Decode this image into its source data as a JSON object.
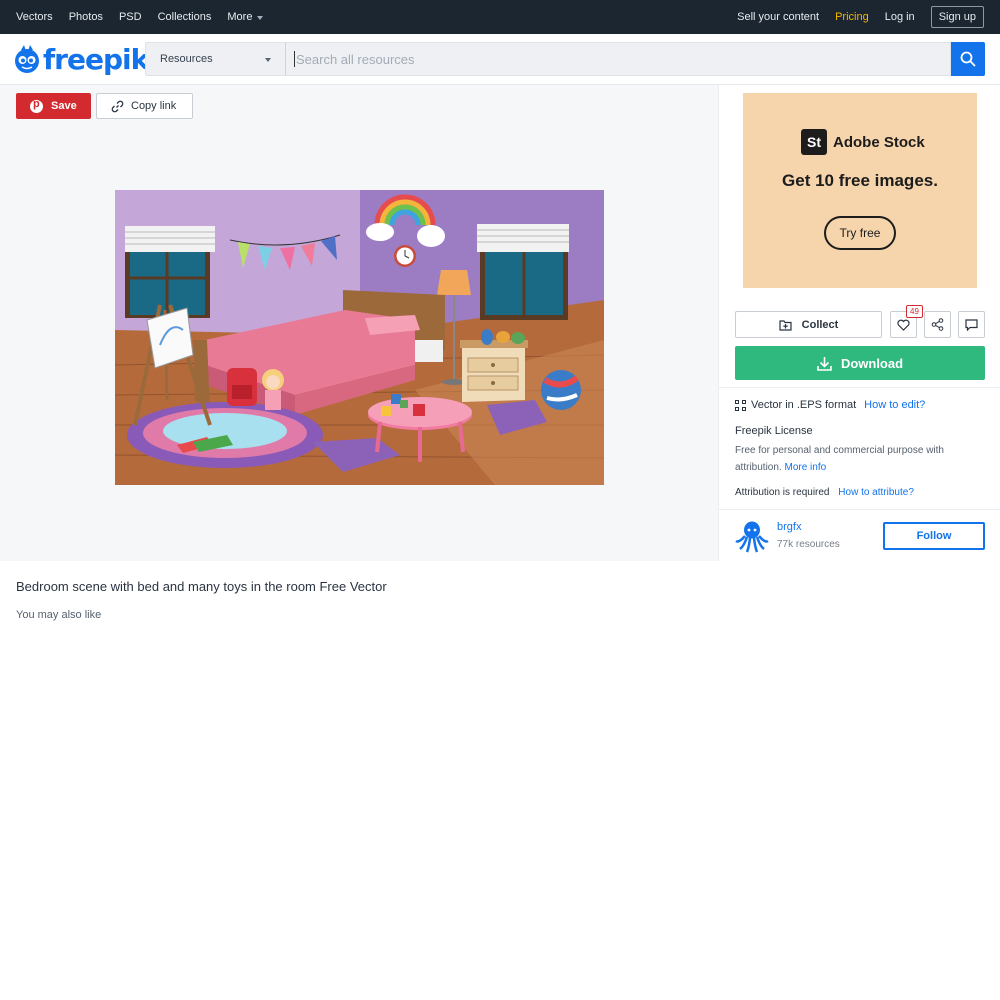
{
  "topnav": {
    "left_items": [
      "Vectors",
      "Photos",
      "PSD",
      "Collections",
      "More"
    ],
    "sell": "Sell your content",
    "pricing": "Pricing",
    "login": "Log in",
    "signup": "Sign up"
  },
  "header": {
    "logo_text": "freepik",
    "search_category": "Resources",
    "search_placeholder": "Search all resources"
  },
  "preview": {
    "save_label": "Save",
    "copy_link_label": "Copy link",
    "image_icon": "bedroom-illustration"
  },
  "ad": {
    "brand_mark": "St",
    "brand_name": "Adobe Stock",
    "headline": "Get 10 free images.",
    "cta": "Try free"
  },
  "actions": {
    "collect_label": "Collect",
    "like_count": "49",
    "download_label": "Download"
  },
  "info": {
    "format_text": "Vector in .EPS format",
    "format_link": "How to edit?",
    "license_title": "Freepik License",
    "license_desc": "Free for personal and commercial purpose with attribution.",
    "license_link": "More info",
    "attribution_text": "Attribution is required",
    "attribution_link": "How to attribute?"
  },
  "author": {
    "name": "brgfx",
    "resources": "77k resources",
    "follow_label": "Follow"
  },
  "page": {
    "title": "Bedroom scene with bed and many toys in the room Free Vector",
    "also_like": "You may also like"
  },
  "colors": {
    "brand_blue": "#1273eb",
    "download_green": "#2fb97f",
    "save_red": "#d22a2e",
    "pricing_yellow": "#f5b400",
    "nav_dark": "#1c2630"
  }
}
